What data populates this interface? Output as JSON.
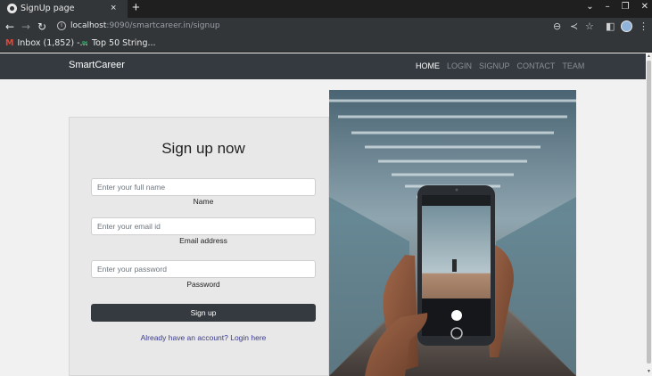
{
  "browser": {
    "tab_title": "SignUp page",
    "tab_close": "×",
    "new_tab": "+",
    "url_host": "localhost",
    "url_rest": ":9090/smartcareer.in/signup",
    "bookmarks": [
      {
        "label": "Inbox (1,852) -...",
        "icon": "gmail-icon"
      },
      {
        "label": "Top 50 String...",
        "icon": "code-icon"
      }
    ]
  },
  "site": {
    "brand": "SmartCareer",
    "nav": [
      "HOME",
      "LOGIN",
      "SIGNUP",
      "CONTACT",
      "TEAM"
    ],
    "active_nav": "HOME"
  },
  "form": {
    "title": "Sign up now",
    "name_placeholder": "Enter your full name",
    "name_label": "Name",
    "email_placeholder": "Enter your email id",
    "email_label": "Email address",
    "password_placeholder": "Enter your password",
    "password_label": "Password",
    "submit_label": "Sign up",
    "login_link": "Already have an account? Login here"
  },
  "colors": {
    "navbar": "#343a40",
    "button": "#343a40",
    "link": "#3b3b8f",
    "page_bg": "#f1f1f1"
  }
}
